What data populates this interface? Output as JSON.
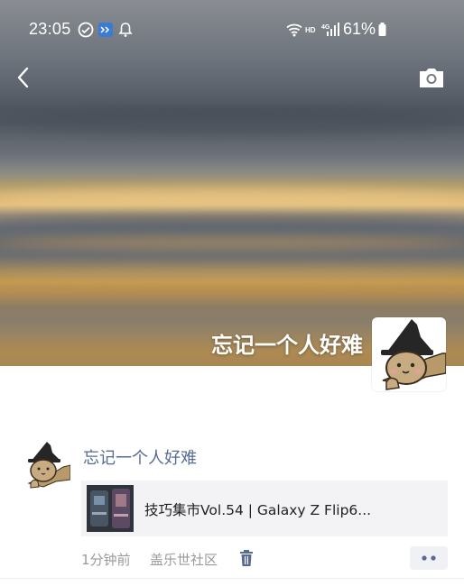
{
  "status_bar": {
    "time": "23:05",
    "battery": "61%",
    "notification_icons": [
      "check-circle-icon",
      "grid-app-icon",
      "bell-icon"
    ],
    "system_icons": [
      "wifi-icon",
      "hd-icon",
      "signal-4g-icon",
      "battery-icon"
    ]
  },
  "header": {
    "back_icon": "chevron-left-icon",
    "camera_icon": "camera-icon"
  },
  "profile": {
    "name": "忘记一个人好难"
  },
  "post": {
    "author": "忘记一个人好难",
    "link_title": "技巧集市Vol.54 | Galaxy Z Flip6...",
    "time": "1分钟前",
    "source": "盖乐世社区",
    "delete_icon": "trash-icon",
    "more_icon": "more-dots-icon"
  },
  "colors": {
    "author_link": "#576b95",
    "meta_text": "#9a9a9a",
    "card_bg": "#f3f3f5",
    "icon_blue": "#576b95"
  }
}
